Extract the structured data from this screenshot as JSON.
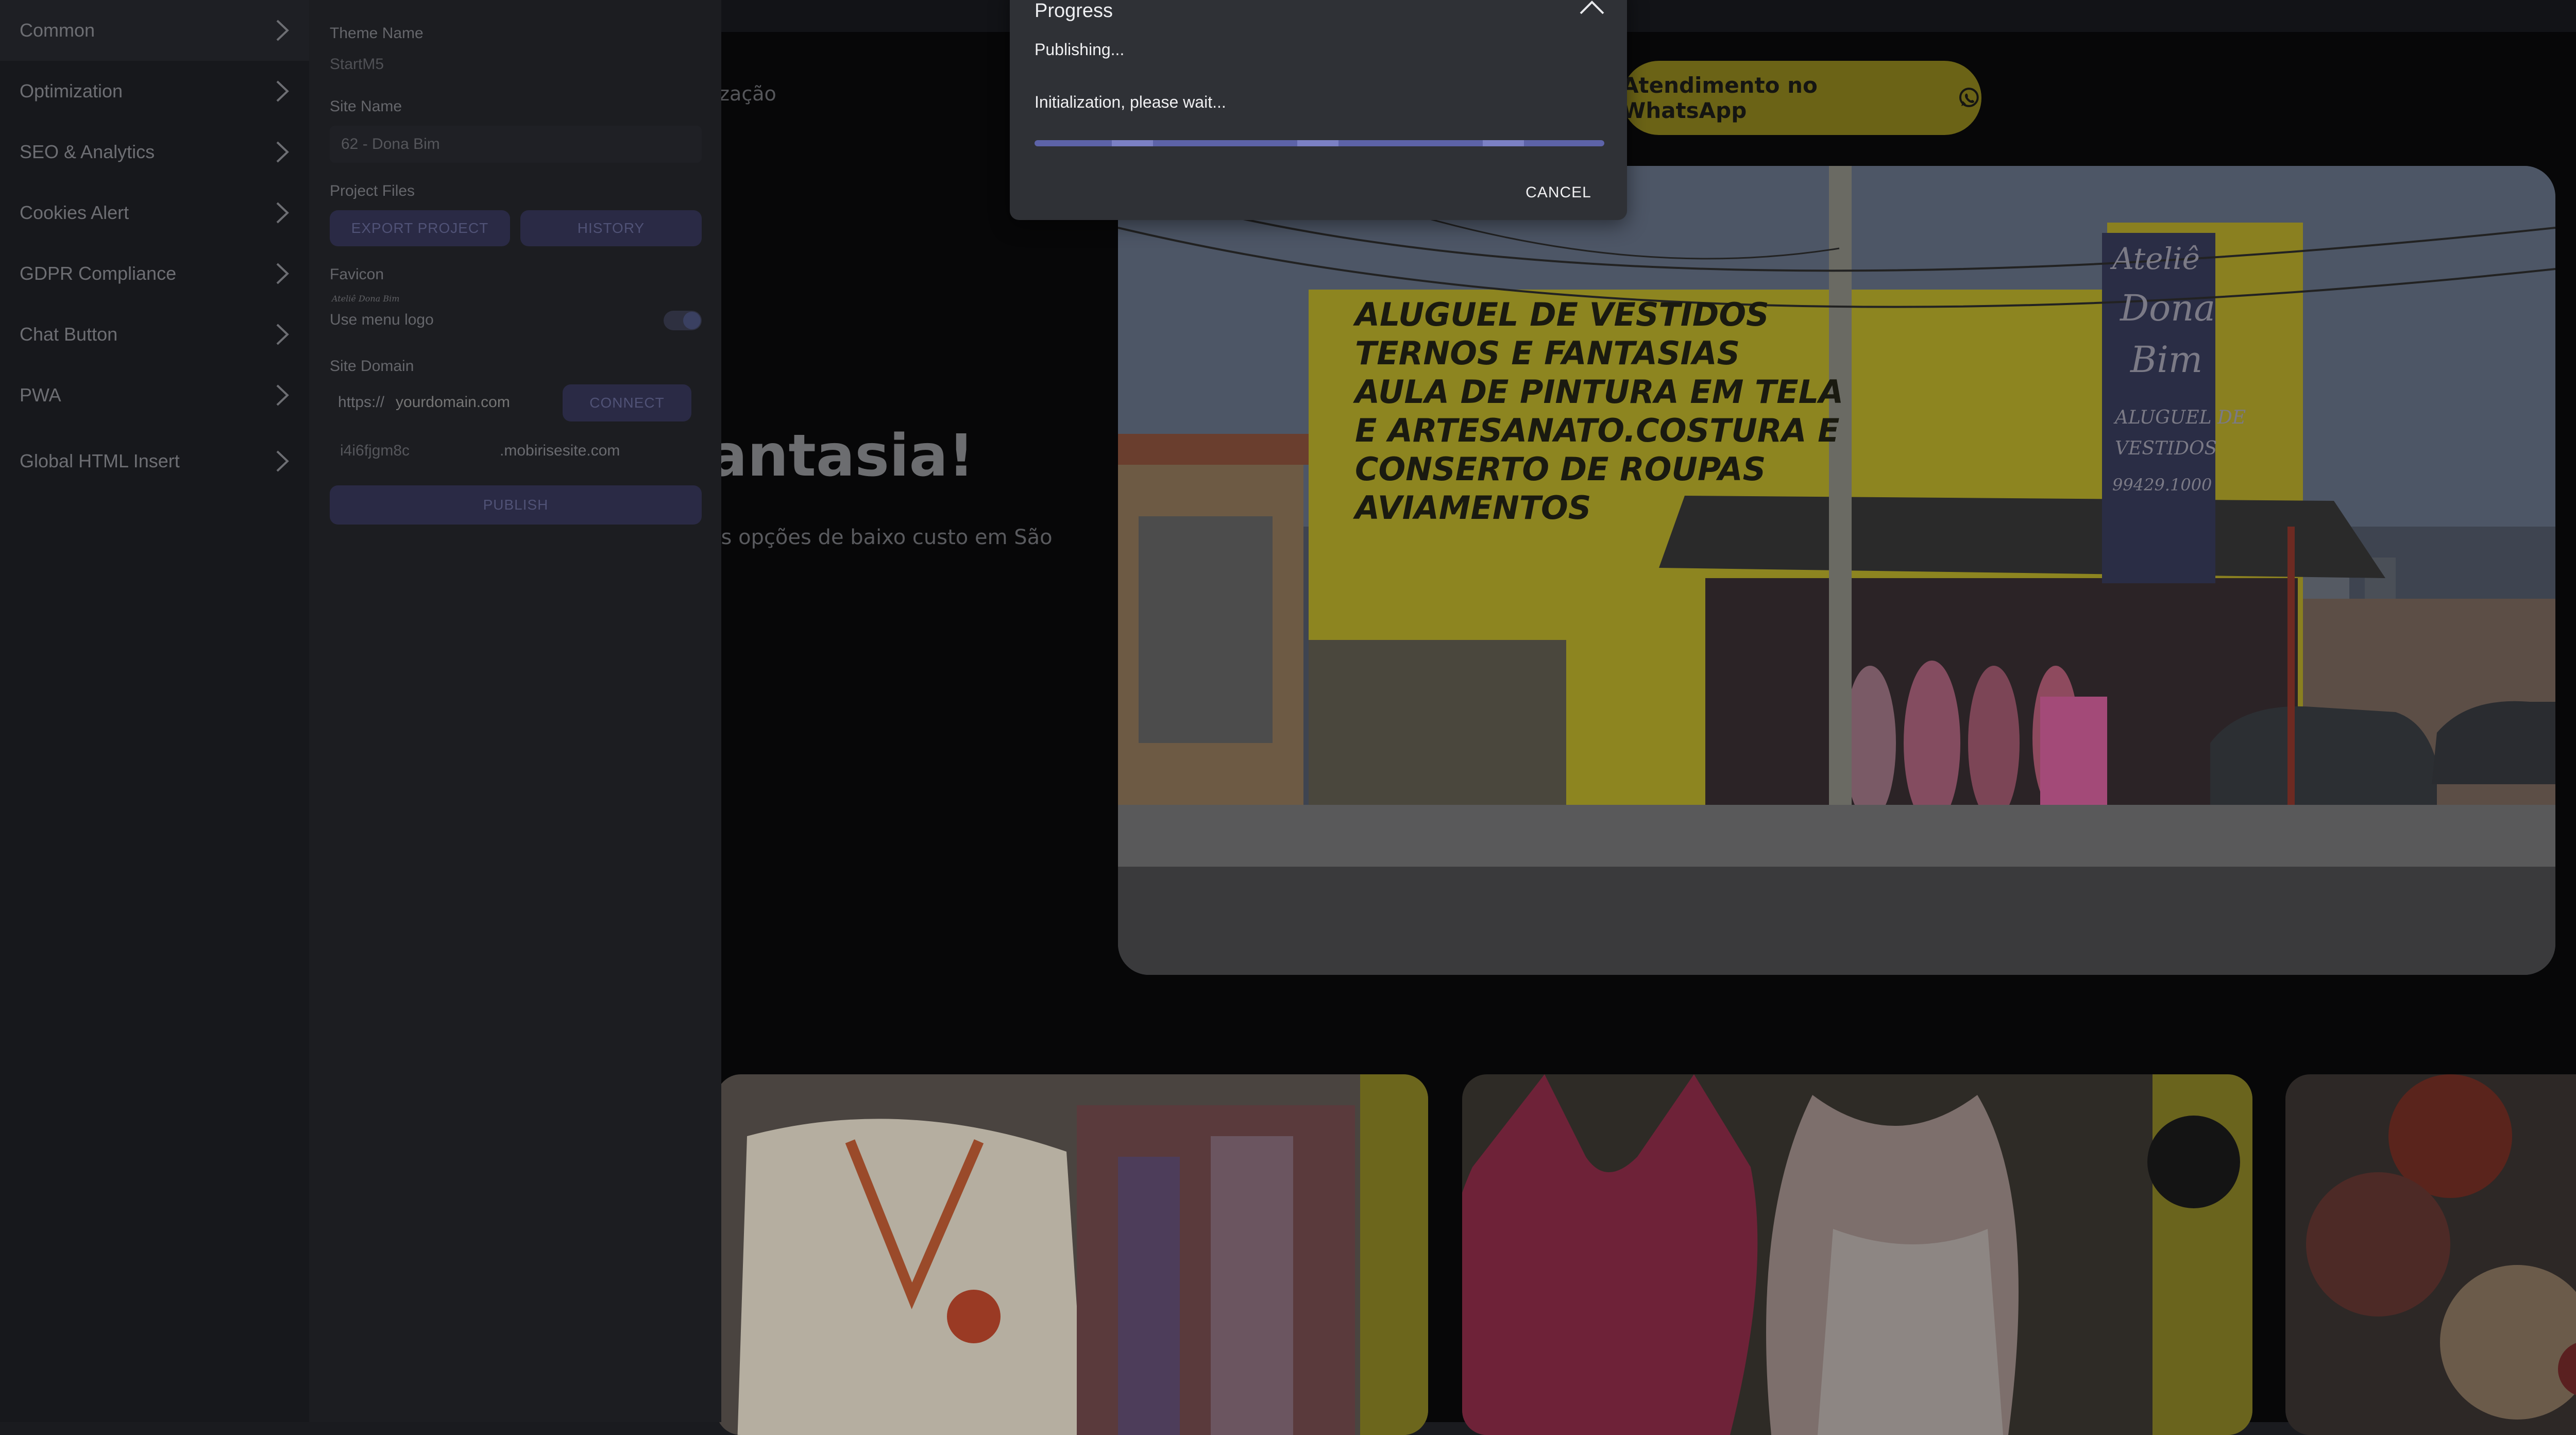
{
  "colors": {
    "dialog_bg": "#2f3136",
    "progress_accent": "#6a70b8",
    "whatsapp_button": "#e8d52a",
    "panel_button": "#2a2a45"
  },
  "left_menu": {
    "items": [
      {
        "label": "Common",
        "icon": "chevron-right-icon"
      },
      {
        "label": "Optimization",
        "icon": "chevron-right-icon"
      },
      {
        "label": "SEO & Analytics",
        "icon": "chevron-right-icon"
      },
      {
        "label": "Cookies Alert",
        "icon": "chevron-right-icon"
      },
      {
        "label": "GDPR Compliance",
        "icon": "chevron-right-icon"
      },
      {
        "label": "Chat Button",
        "icon": "chevron-right-icon"
      },
      {
        "label": "PWA",
        "icon": "chevron-right-icon"
      },
      {
        "label": "Global HTML Insert",
        "icon": "chevron-right-icon"
      }
    ]
  },
  "settings": {
    "theme_name_label": "Theme Name",
    "theme_name_value": "StartM5",
    "site_name_label": "Site Name",
    "site_name_value": "62 - Dona Bim",
    "project_files_label": "Project Files",
    "export_project_label": "EXPORT PROJECT",
    "history_label": "HISTORY",
    "favicon_label": "Favicon",
    "favicon_logo_text": "Ateliê Dona Bim",
    "use_menu_logo_label": "Use menu logo",
    "use_menu_logo_on": true,
    "site_domain_label": "Site Domain",
    "domain_prefix": "https://",
    "domain_placeholder": "yourdomain.com",
    "connect_label": "CONNECT",
    "subdomain_value": "i4i6fjgm8c",
    "subdomain_suffix": ".mobirisesite.com",
    "publish_label": "PUBLISH"
  },
  "dialog": {
    "title": "Progress",
    "status": "Publishing...",
    "message": "Initialization, please wait...",
    "progress": 1.0,
    "cancel_label": "CANCEL",
    "close_icon": "chevron-up-icon"
  },
  "preview": {
    "nav_text": "lização",
    "whatsapp_button_label": "Atendimento no WhatsApp",
    "whatsapp_icon": "whatsapp-icon",
    "hero_title": "antasia!",
    "hero_description": "as opções de baixo custo em São",
    "storefront_sign": [
      "ALUGUEL DE VESTIDOS",
      "TERNOS E FANTASIAS",
      "AULA DE PINTURA EM TELA",
      "E ARTESANATO.COSTURA E",
      "CONSERTO DE ROUPAS",
      "AVIAMENTOS"
    ],
    "storefront_side_sign": [
      "Ateliê",
      "Dona",
      "Bim",
      "ALUGUEL DE",
      "VESTIDOS",
      "99429.1000"
    ],
    "fab_icon": "plus-icon"
  }
}
